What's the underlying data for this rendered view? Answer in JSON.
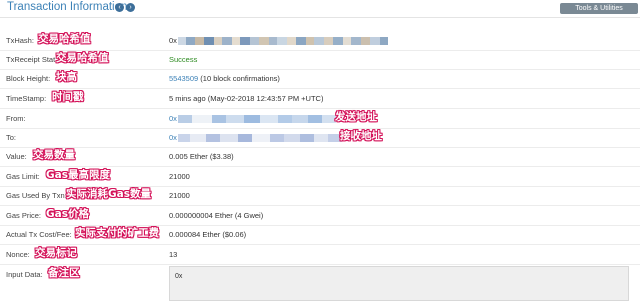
{
  "header": {
    "title": "Transaction Information",
    "tools_label": "Tools & Utilities",
    "prev_icon": "chevron-left-icon",
    "next_icon": "chevron-right-icon",
    "prev_glyph": "‹",
    "next_glyph": "›"
  },
  "rows": [
    {
      "label": "TxHash:",
      "annotation": "交易哈希值",
      "value": "0x"
    },
    {
      "label": "TxReceipt Stat",
      "annotation": "交易哈希值",
      "value": "Success"
    },
    {
      "label": "Block Height:",
      "annotation": "块高",
      "value_link": "5543509",
      "value_rest": " (10 block confirmations)"
    },
    {
      "label": "TimeStamp:",
      "annotation": "时间戳",
      "value": "5 mins ago (May-02-2018 12:43:57 PM +UTC)"
    },
    {
      "label": "From:",
      "annotation": "",
      "value": "0x",
      "side_annotation": "发送地址"
    },
    {
      "label": "To:",
      "annotation": "",
      "value": "0x",
      "side_annotation": "接收地址"
    },
    {
      "label": "Value:",
      "annotation": "交易数量",
      "value": "0.005 Ether ($3.38)"
    },
    {
      "label": "Gas Limit:",
      "annotation": "Gas最高限度",
      "value": "21000"
    },
    {
      "label": "Gas Used By Txn:",
      "annotation": "实际消耗Gas数量",
      "value": "21000"
    },
    {
      "label": "Gas Price:",
      "annotation": "Gas价格",
      "value": "0.000000004 Ether (4 Gwei)"
    },
    {
      "label": "Actual Tx Cost/Fee:",
      "annotation": "实际支付的矿工费",
      "value": "0.000084 Ether ($0.06)"
    },
    {
      "label": "Nonce:",
      "annotation": "交易标记",
      "value": "13"
    },
    {
      "label": "Input Data:",
      "annotation": "备注区",
      "value": "0x"
    }
  ],
  "colors": {
    "accent": "#3d82b7",
    "success": "#2e8b22",
    "annotation_outline": "#d4145a"
  }
}
